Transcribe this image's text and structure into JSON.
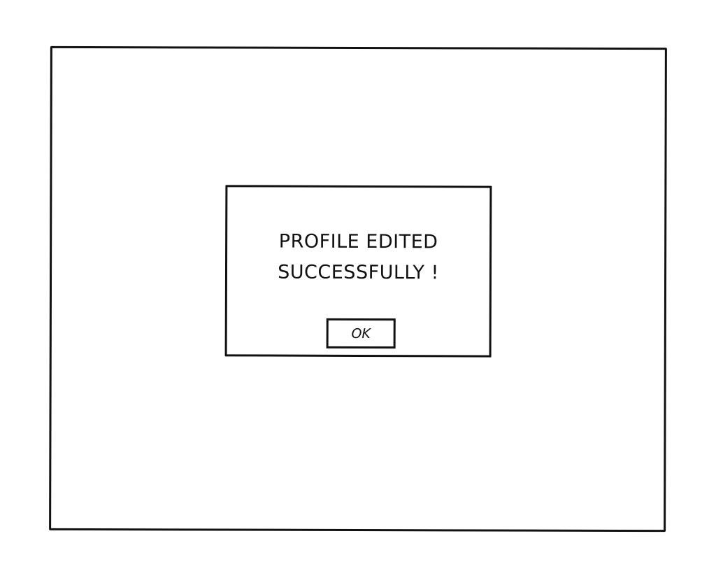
{
  "dialog": {
    "message_line1": "PROFILE EDITED",
    "message_line2": "SUCCESSFULLY !",
    "ok_label": "OK"
  },
  "colors": {
    "ink": "#111111",
    "background": "#ffffff"
  }
}
